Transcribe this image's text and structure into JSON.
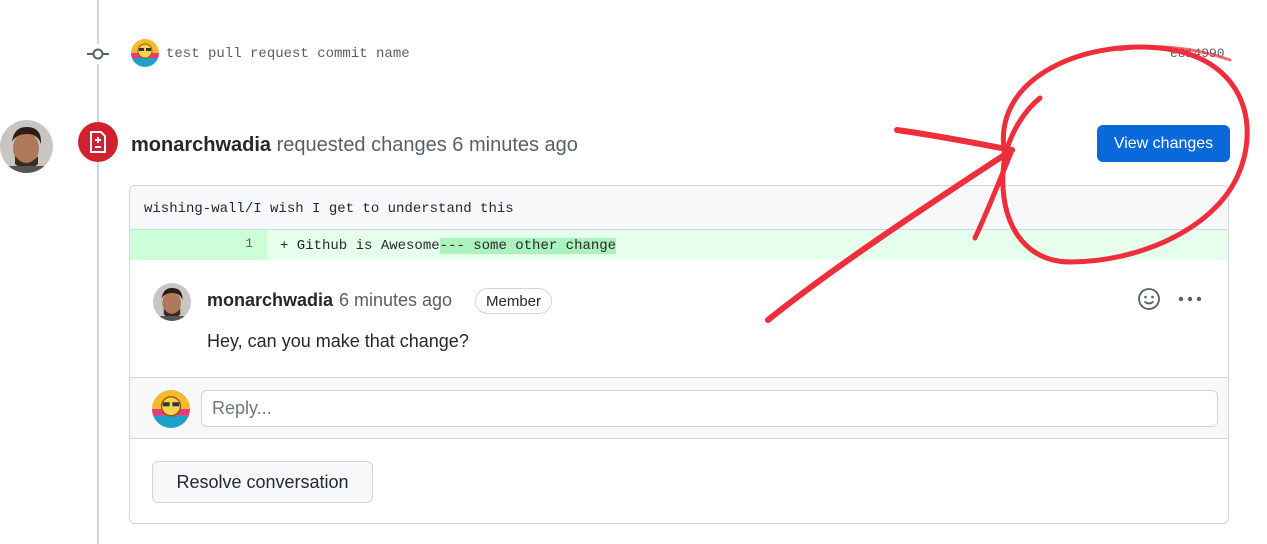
{
  "commit": {
    "message": "test pull request commit name",
    "sha": "e814990"
  },
  "review": {
    "author": "monarchwadia",
    "action": " requested changes 6 minutes ago",
    "view_changes_label": "View changes"
  },
  "thread": {
    "file_path": "wishing-wall/I wish I get to understand this",
    "diff": {
      "line_number": "1",
      "code_prefix": "+ Github is Awesome",
      "code_highlight": "--- some other change"
    },
    "comment": {
      "author": "monarchwadia",
      "time": "6 minutes ago",
      "badge": "Member",
      "body": "Hey, can you make that change?"
    },
    "reply_placeholder": "Reply...",
    "resolve_label": "Resolve conversation"
  },
  "colors": {
    "accent_blue": "#0969da",
    "changes_requested_red": "#cf222e",
    "diff_added_bg": "#e6ffec",
    "annotation_red": "#ee2e3a"
  },
  "icons": [
    "git-commit-icon",
    "file-diff-icon",
    "smiley-icon",
    "kebab-icon"
  ]
}
